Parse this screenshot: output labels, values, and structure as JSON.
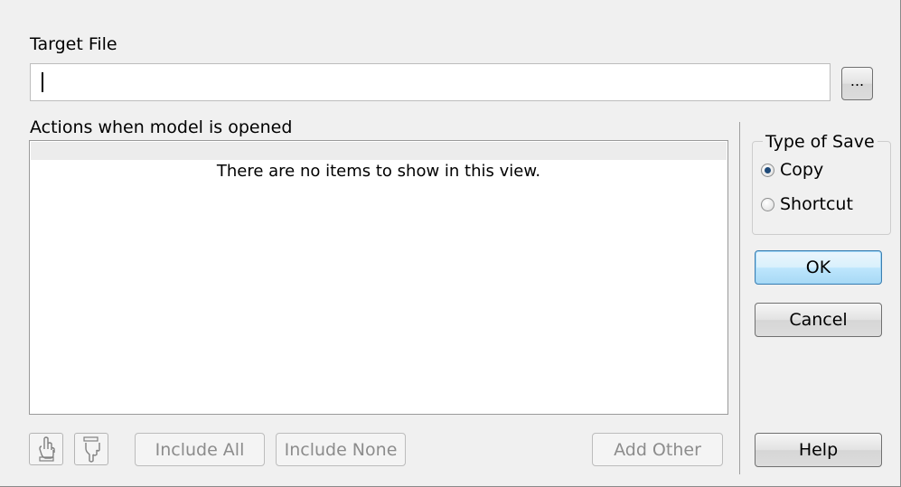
{
  "target_file": {
    "label": "Target File",
    "value": "",
    "browse_label": "..."
  },
  "actions": {
    "label": "Actions when model is opened",
    "empty_message": "There are no items to show in this view."
  },
  "type_of_save": {
    "legend": "Type of Save",
    "options": [
      {
        "label": "Copy",
        "checked": true
      },
      {
        "label": "Shortcut",
        "checked": false
      }
    ]
  },
  "buttons": {
    "ok": "OK",
    "cancel": "Cancel",
    "help": "Help",
    "include_all": "Include All",
    "include_none": "Include None",
    "add_other": "Add Other"
  },
  "icons": {
    "move_up": "hand-pointing-up-icon",
    "move_down": "hand-pointing-down-icon"
  }
}
